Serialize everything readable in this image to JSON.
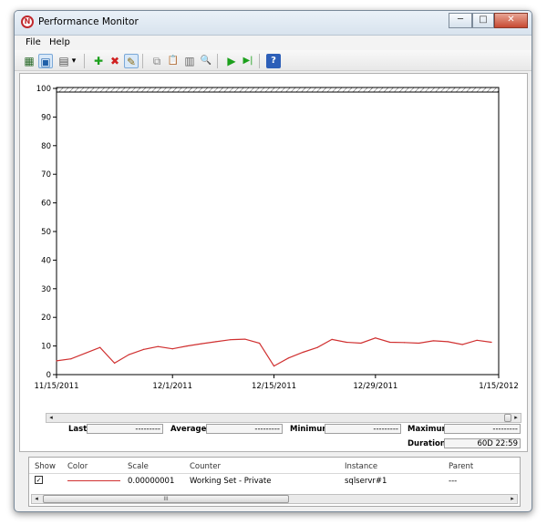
{
  "window": {
    "title": "Performance Monitor",
    "min": "─",
    "max": "□",
    "close": "✕"
  },
  "menu": {
    "file": "File",
    "help": "Help"
  },
  "toolbar": {
    "view_graph": "▦",
    "view_current": "▣",
    "change_graph": "▤",
    "dropdown": "▾",
    "add": "✚",
    "delete": "✖",
    "highlight": "✎",
    "copy": "⧉",
    "paste": "📋",
    "properties": "▥",
    "zoom": "🔍",
    "play": "▶",
    "step": "▶|",
    "help": "?"
  },
  "chart_data": {
    "type": "line",
    "ylim": [
      0,
      100
    ],
    "yticks": [
      "0",
      "10",
      "20",
      "30",
      "40",
      "50",
      "60",
      "70",
      "80",
      "90",
      "100"
    ],
    "xticks": [
      {
        "label": "11/15/2011"
      },
      {
        "label": "12/1/2011"
      },
      {
        "label": "12/15/2011"
      },
      {
        "label": "12/29/2011"
      },
      {
        "label": "1/15/2012"
      }
    ],
    "series": [
      {
        "color": "#d03030",
        "x": [
          "2011-11-15",
          "2011-11-17",
          "2011-11-19",
          "2011-11-21",
          "2011-11-23",
          "2011-11-25",
          "2011-11-27",
          "2011-11-29",
          "2011-12-01",
          "2011-12-03",
          "2011-12-05",
          "2011-12-07",
          "2011-12-09",
          "2011-12-11",
          "2011-12-13",
          "2011-12-15",
          "2011-12-17",
          "2011-12-19",
          "2011-12-21",
          "2011-12-23",
          "2011-12-25",
          "2011-12-27",
          "2011-12-29",
          "2011-12-31",
          "2012-01-02",
          "2012-01-04",
          "2012-01-06",
          "2012-01-08",
          "2012-01-10",
          "2012-01-12",
          "2012-01-14"
        ],
        "values": [
          4.8,
          5.5,
          7.5,
          9.5,
          4.0,
          7.0,
          8.8,
          9.8,
          9.0,
          10.0,
          10.8,
          11.5,
          12.2,
          12.4,
          11.0,
          3.0,
          5.8,
          7.8,
          9.5,
          12.3,
          11.3,
          11.0,
          12.8,
          11.3,
          11.2,
          11.0,
          11.8,
          11.5,
          10.5,
          12.0,
          11.3
        ]
      }
    ]
  },
  "hscroll": {
    "left": "◂",
    "right": "▸"
  },
  "stats": {
    "last_label": "Last",
    "last_value": "---------",
    "average_label": "Average",
    "average_value": "---------",
    "minimum_label": "Minimum",
    "minimum_value": "---------",
    "maximum_label": "Maximum",
    "maximum_value": "---------",
    "duration_label": "Duration",
    "duration_value": "60D 22:59"
  },
  "legend": {
    "headers": {
      "show": "Show",
      "color": "Color",
      "scale": "Scale",
      "counter": "Counter",
      "instance": "Instance",
      "parent": "Parent"
    },
    "row": {
      "show_check": "✓",
      "scale": "0.00000001",
      "counter": "Working Set - Private",
      "instance": "sqlservr#1",
      "parent": "---"
    },
    "row_color": "#d03030",
    "scroll_left": "◂",
    "scroll_right": "▸",
    "scroll_grip": "III"
  }
}
